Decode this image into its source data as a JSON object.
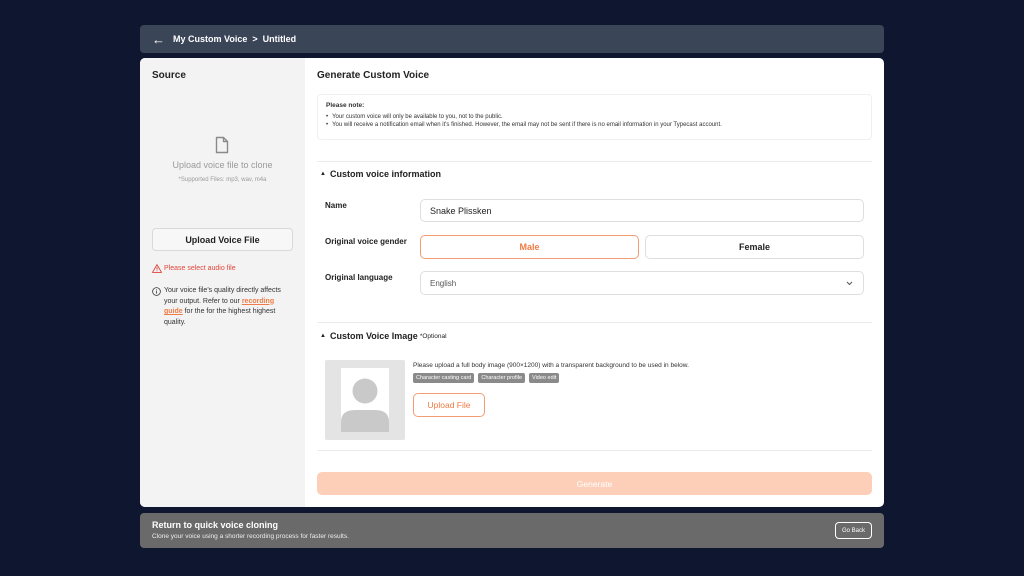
{
  "topbar": {
    "back_icon": "←",
    "crumb_parent": "My Custom Voice",
    "crumb_sep": ">",
    "crumb_current": "Untitled"
  },
  "source": {
    "title": "Source",
    "upload_hint": "Upload voice file to clone",
    "supported": "*Supported Files: mp3, wav, m4a",
    "upload_button": "Upload Voice File",
    "error": "Please select audio file",
    "info_before": "Your voice file's quality directly affects your output. Refer to our ",
    "info_link": "recording guide",
    "info_after": " for the for the highest highest quality."
  },
  "main": {
    "title": "Generate Custom Voice",
    "note_title": "Please note:",
    "note_items": [
      "Your custom voice will only be available to you, not to the public.",
      "You will receive a notification email when it's finished. However, the email may not be sent if there is no email information in your Typecast account."
    ],
    "info_section": {
      "title": "Custom voice information",
      "name_label": "Name",
      "name_value": "Snake Plissken",
      "gender_label": "Original voice gender",
      "gender_male": "Male",
      "gender_female": "Female",
      "gender_selected": "Male",
      "language_label": "Original language",
      "language_value": "English"
    },
    "image_section": {
      "title": "Custom Voice Image",
      "optional": "*Optional",
      "description": "Please upload a full body image (900×1200) with a transparent background to be used in below.",
      "tags": [
        "Character casting card",
        "Character profile",
        "Video edit"
      ],
      "upload_button": "Upload File"
    },
    "generate_button": "Generate"
  },
  "bottom": {
    "title": "Return to quick voice cloning",
    "subtitle": "Clone your voice using a shorter recording process for faster results.",
    "button": "Go Back"
  },
  "colors": {
    "accent": "#f07b45",
    "background": "#0f1730",
    "error": "#e0463c"
  }
}
